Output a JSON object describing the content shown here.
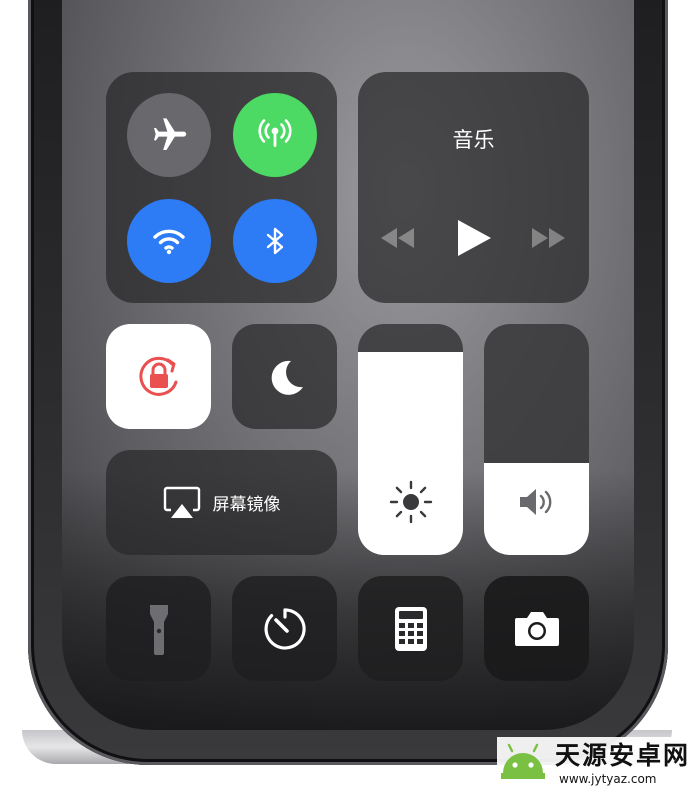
{
  "control_center": {
    "music": {
      "title": "音乐"
    },
    "screen_mirroring": {
      "label": "屏幕镜像"
    },
    "brightness": {
      "level": 0.88
    },
    "volume": {
      "level": 0.4
    },
    "connectivity": {
      "airplane_mode": false,
      "cellular_data": true,
      "wifi": true,
      "bluetooth": true
    },
    "orientation_lock": true
  },
  "colors": {
    "cellular": "#4cd964",
    "active_blue": "#2d7cf6",
    "lock_red": "#e9504f"
  },
  "watermark": {
    "brand": "天源安卓网",
    "url": "www.jytyaz.com"
  }
}
